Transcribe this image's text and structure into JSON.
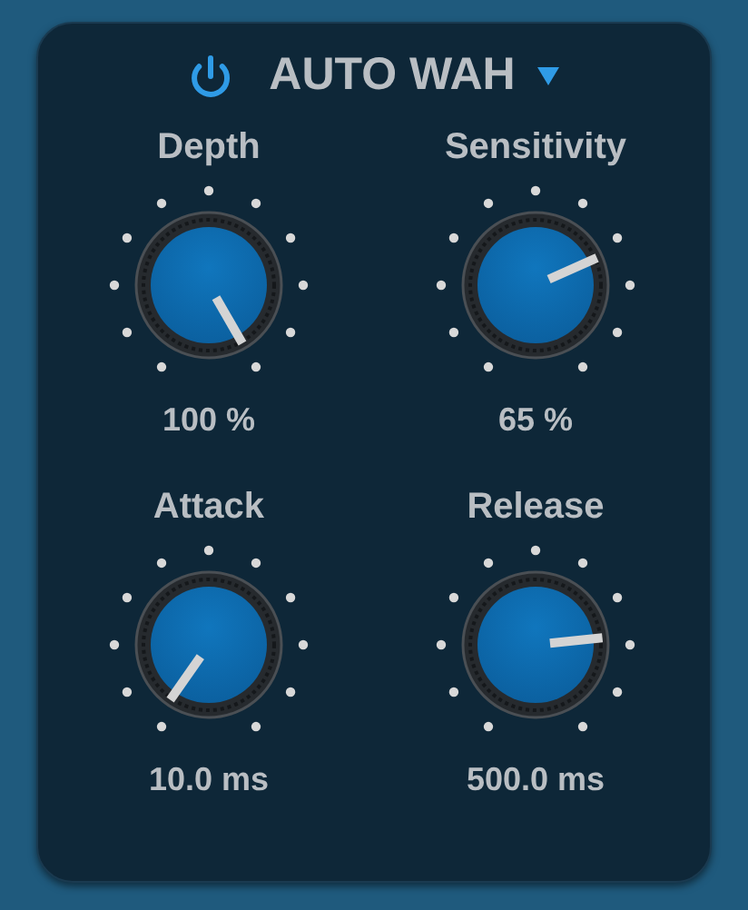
{
  "header": {
    "power_on": true,
    "title": "AUTO WAH"
  },
  "knobs": [
    {
      "label": "Depth",
      "reading": "100 %"
    },
    {
      "label": "Sensitivity",
      "reading": "65 %"
    },
    {
      "label": "Attack",
      "reading": "10.0 ms"
    },
    {
      "label": "Release",
      "reading": "500.0 ms"
    }
  ]
}
